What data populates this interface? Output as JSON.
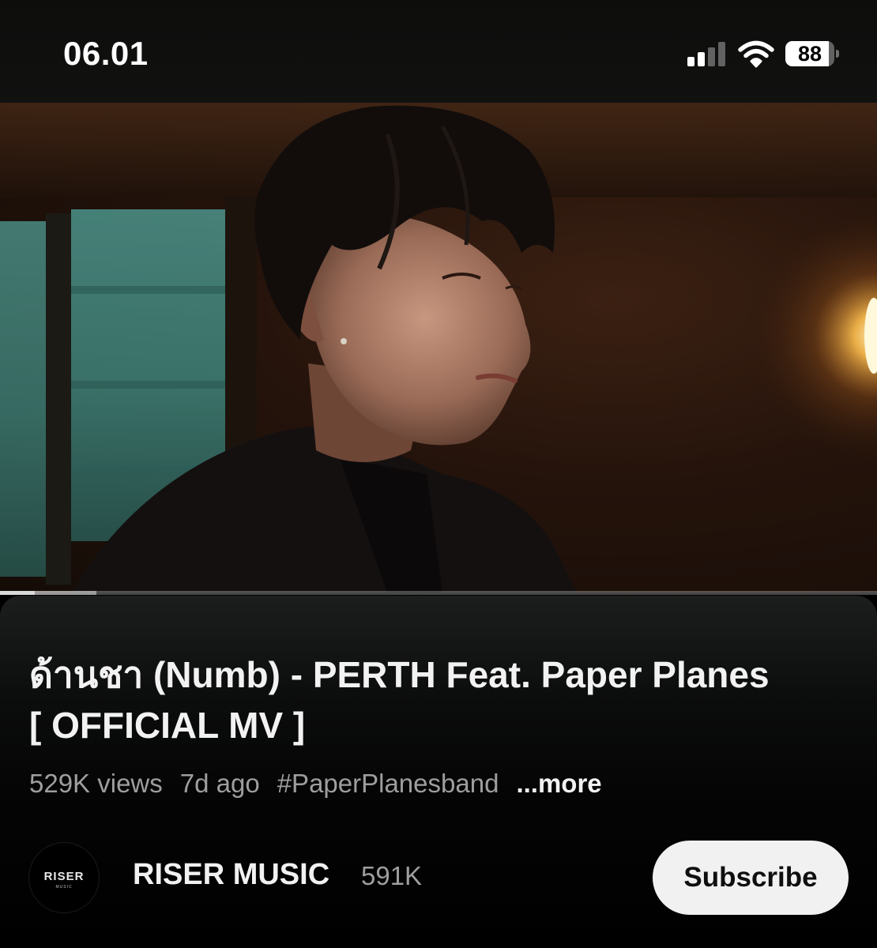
{
  "status_bar": {
    "time": "06.01",
    "signal_bars_active": 2,
    "signal_bars_total": 4,
    "wifi": "wifi-icon",
    "battery_label": "88",
    "battery_level": 0.88
  },
  "video": {
    "progress_played_fraction": 0.04,
    "progress_buffered_fraction": 0.11
  },
  "info": {
    "title": "ด้านชา (Numb) - PERTH Feat. Paper Planes [ OFFICIAL MV ]",
    "views": "529K views",
    "age": "7d ago",
    "hashtag": "#PaperPlanesband",
    "more_label": "...more"
  },
  "channel": {
    "avatar_text": "RISER",
    "avatar_subtext": "MUSIC",
    "name": "RISER MUSIC",
    "subscribers": "591K",
    "subscribe_label": "Subscribe"
  },
  "colors": {
    "background": "#000000",
    "text_primary": "#f2f2f2",
    "text_secondary": "#9e9e9e",
    "subscribe_bg": "#f1f1f1",
    "subscribe_text": "#0f0f0f"
  }
}
